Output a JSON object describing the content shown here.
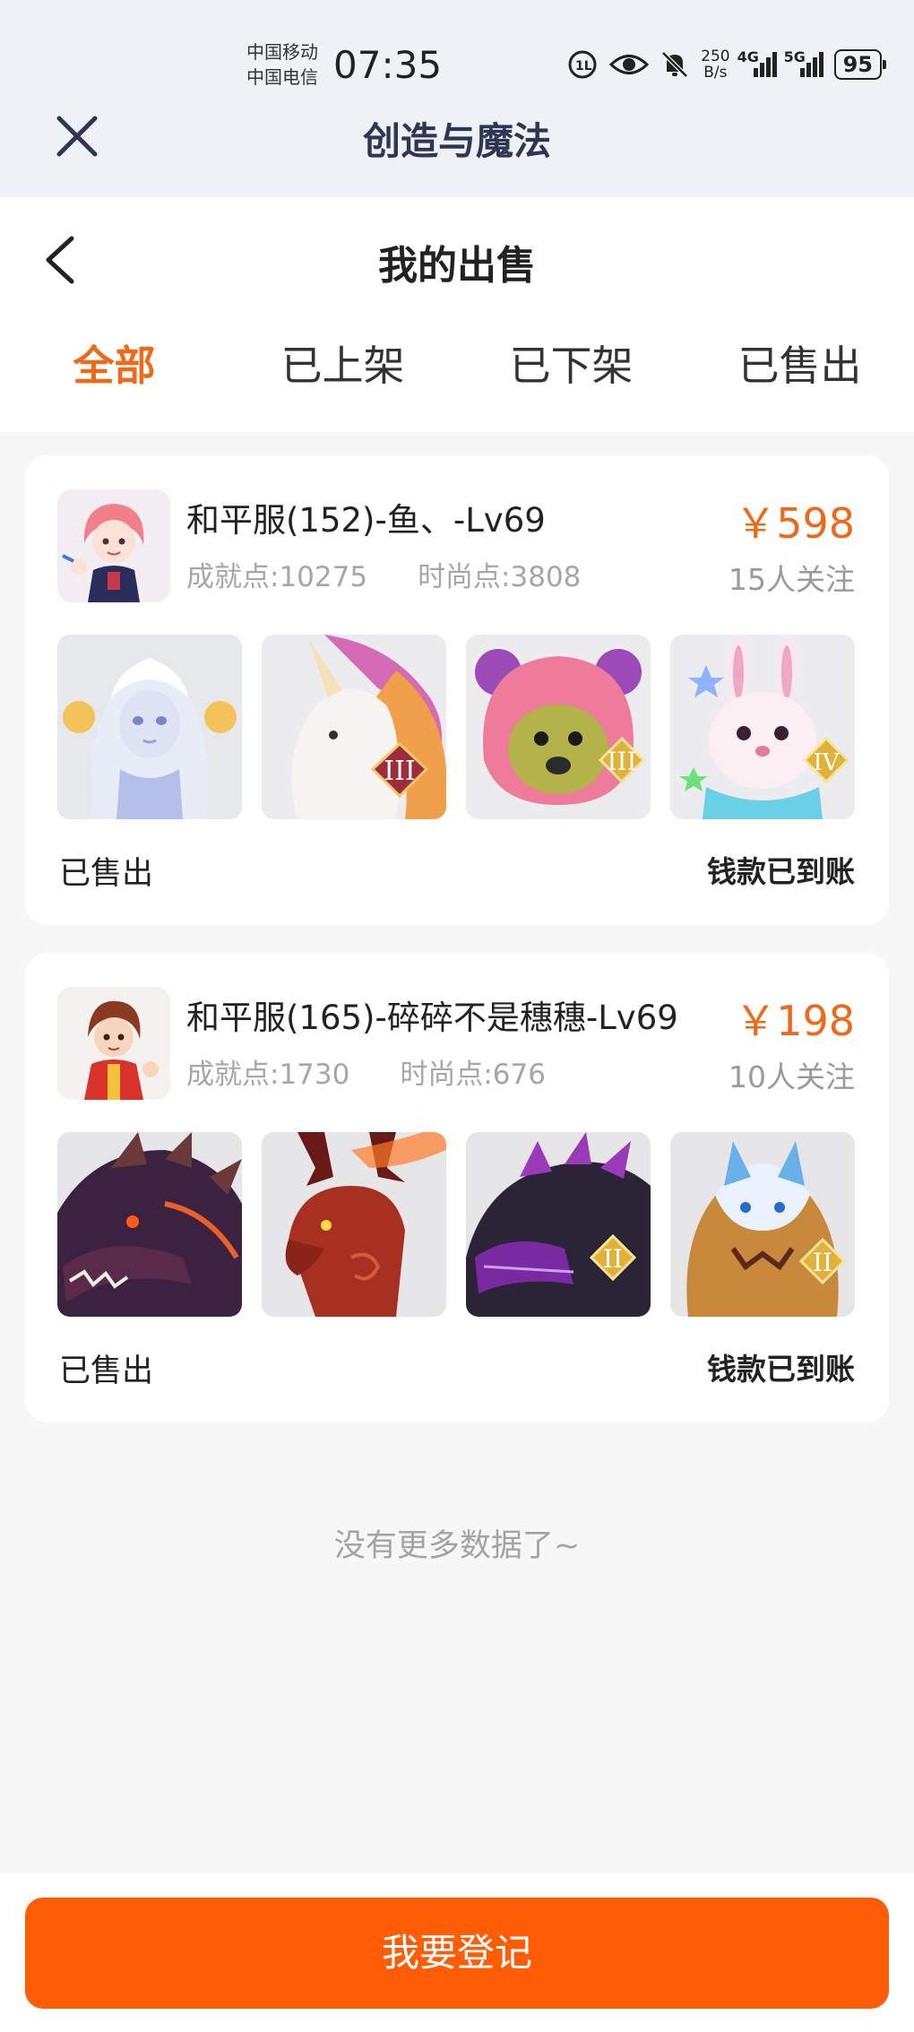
{
  "status_bar": {
    "carrier_1": "中国移动",
    "carrier_2": "中国电信",
    "time": "07:35",
    "net_speed_value": "250",
    "net_speed_unit": "B/s",
    "signal_1": "4G",
    "signal_2": "5G",
    "battery": "95"
  },
  "app_bar": {
    "title": "创造与魔法"
  },
  "page": {
    "title": "我的出售"
  },
  "tabs": [
    {
      "label": "全部",
      "active": true
    },
    {
      "label": "已上架",
      "active": false
    },
    {
      "label": "已下架",
      "active": false
    },
    {
      "label": "已售出",
      "active": false
    }
  ],
  "listings": [
    {
      "title": "和平服(152)-鱼、-Lv69",
      "achievement": "成就点:10275",
      "fashion": "时尚点:3808",
      "price": "￥598",
      "followers": "15人关注",
      "item_badges": [
        "",
        "III",
        "III",
        "IV"
      ],
      "status": "已售出",
      "payment": "钱款已到账"
    },
    {
      "title": "和平服(165)-碎碎不是穗穗-Lv69",
      "achievement": "成就点:1730",
      "fashion": "时尚点:676",
      "price": "￥198",
      "followers": "10人关注",
      "item_badges": [
        "",
        "",
        "II",
        "II"
      ],
      "status": "已售出",
      "payment": "钱款已到账"
    }
  ],
  "end_note": "没有更多数据了~",
  "register_button": "我要登记",
  "colors": {
    "accent": "#ee6a1b",
    "button": "#ff5d05",
    "title_dark": "#2f3654"
  }
}
